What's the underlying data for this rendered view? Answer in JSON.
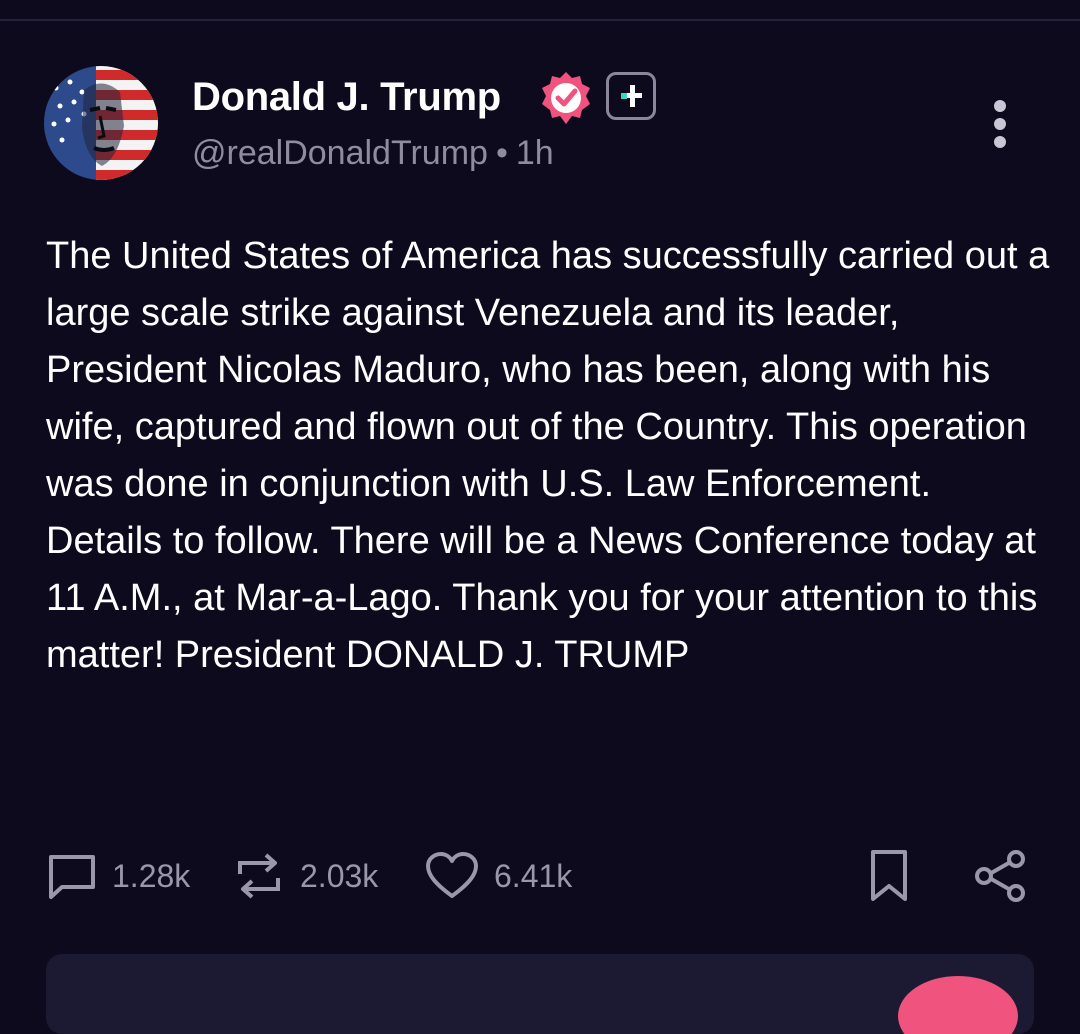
{
  "post": {
    "author": {
      "name": "Donald J. Trump",
      "handle": "@realDonaldTrump",
      "separator": "•",
      "time": "1h",
      "verified": true,
      "avatar": "avatar-flag-portrait"
    },
    "text": "The United States of America has successfully carried out a large scale strike against Venezuela and its leader, President Nicolas Maduro, who has been, along with his wife, captured and flown out of the Country. This operation was done in conjunction with U.S. Law Enforcement. Details to follow. There will be a News Conference today at 11 A.M., at Mar-a-Lago. Thank you for your attention to this matter! President DONALD J. TRUMP",
    "actions": {
      "replies": "1.28k",
      "reposts": "2.03k",
      "likes": "6.41k"
    }
  },
  "icons": {
    "verified": "verified-badge-icon",
    "plus": "plus-badge-icon",
    "more": "more-vertical-icon",
    "reply": "comment-icon",
    "repost": "repost-icon",
    "like": "heart-icon",
    "bookmark": "bookmark-icon",
    "share": "share-icon"
  },
  "colors": {
    "background": "#0d0a1d",
    "text": "#ffffff",
    "muted": "#8f8ca0",
    "verified": "#f0547e",
    "plus_accent": "#3ad9c4",
    "reply_box": "#1c1932"
  }
}
